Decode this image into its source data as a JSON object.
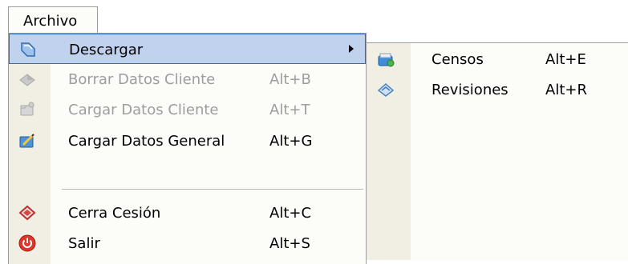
{
  "menubar": {
    "archivo_label": "Archivo"
  },
  "menu": {
    "items": [
      {
        "label": "Descargar",
        "shortcut": "",
        "icon": "download-icon"
      },
      {
        "label": "Borrar Datos Cliente",
        "shortcut": "Alt+B",
        "icon": "erase-icon"
      },
      {
        "label": "Cargar Datos Cliente",
        "shortcut": "Alt+T",
        "icon": "load-client-icon"
      },
      {
        "label": "Cargar Datos General",
        "shortcut": "Alt+G",
        "icon": "load-general-icon"
      },
      {
        "label": "Cerra Cesión",
        "shortcut": "Alt+C",
        "icon": "logout-icon"
      },
      {
        "label": "Salir",
        "shortcut": "Alt+S",
        "icon": "power-icon"
      }
    ]
  },
  "submenu": {
    "items": [
      {
        "label": "Censos",
        "shortcut": "Alt+E",
        "icon": "census-icon"
      },
      {
        "label": "Revisiones",
        "shortcut": "Alt+R",
        "icon": "revisions-icon"
      }
    ]
  },
  "colors": {
    "highlight_bg": "#c1d2ee",
    "highlight_border": "#3169c6",
    "gutter": "#f1efe3",
    "disabled_text": "#9d9d9d"
  }
}
